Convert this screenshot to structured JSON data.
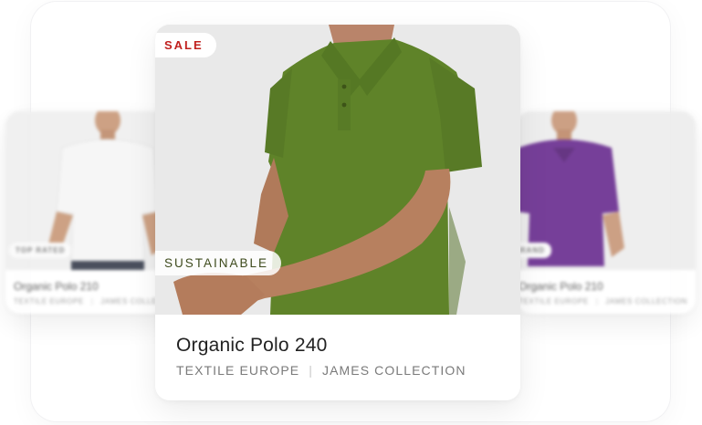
{
  "main_product": {
    "badge_top": "SALE",
    "badge_bottom": "SUSTAINABLE",
    "title": "Organic Polo 240",
    "brand": "TEXTILE EUROPE",
    "collection": "JAMES COLLECTION",
    "shirt_color": "#5e8228",
    "sale_color": "#c0201e"
  },
  "left_product": {
    "badge": "TOP RATED",
    "title": "Organic Polo 210",
    "brand": "TEXTILE EUROPE",
    "collection": "JAMES COLLECTION",
    "shirt_color": "#f4f4f4"
  },
  "right_product": {
    "badge": "BRAND",
    "title": "Organic Polo 210",
    "brand": "TEXTILE EUROPE",
    "collection": "JAMES COLLECTION",
    "shirt_color": "#6b2f91"
  }
}
